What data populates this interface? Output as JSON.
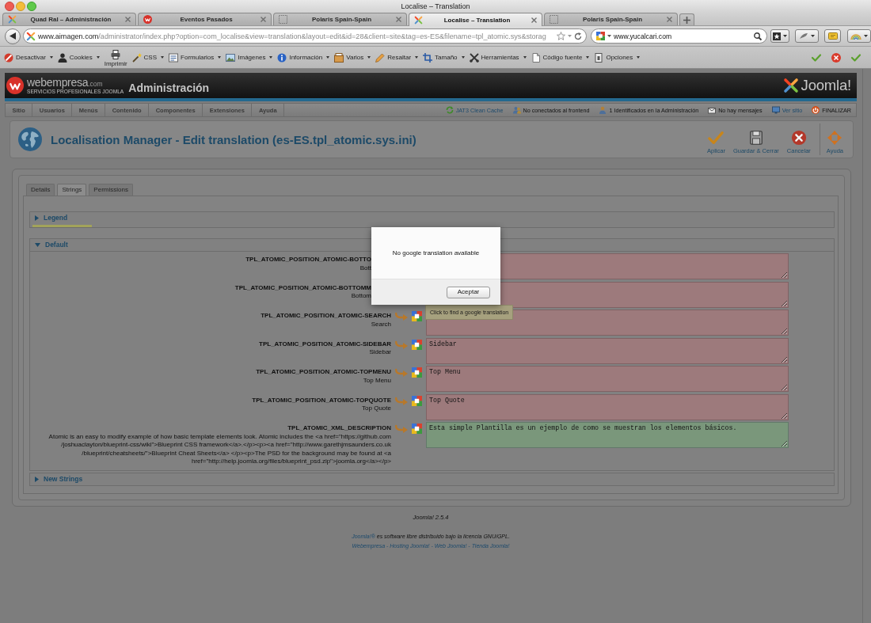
{
  "window": {
    "title": "Localise – Translation"
  },
  "tabs": [
    {
      "title": "Quad Ral – Administración",
      "kind": "joomla",
      "selected": false
    },
    {
      "title": "Eventos Pasados",
      "kind": "webempresa",
      "selected": false
    },
    {
      "title": "Polaris Spain-Spain",
      "kind": "blank",
      "selected": false
    },
    {
      "title": "Localise – Translation",
      "kind": "joomla",
      "selected": true
    },
    {
      "title": "Polaris Spain-Spain",
      "kind": "blank",
      "selected": false
    }
  ],
  "address_bar": {
    "host": "www.aimagen.com",
    "path": "/administrator/index.php?option=com_localise&view=translation&layout=edit&id=28&client=site&tag=es-ES&filename=tpl_atomic.sys&storag"
  },
  "search_field": {
    "value": "www.yucalcari.com"
  },
  "developer_toolbar": {
    "items": [
      {
        "label": "Desactivar",
        "kind": "menu"
      },
      {
        "label": "Cookies",
        "kind": "menu"
      },
      {
        "label": "Imprimir",
        "kind": "stacked"
      },
      {
        "label": "CSS",
        "kind": "menu"
      },
      {
        "label": "Formularios",
        "kind": "menu"
      },
      {
        "label": "Imágenes",
        "kind": "menu"
      },
      {
        "label": "Información",
        "kind": "menu"
      },
      {
        "label": "Varios",
        "kind": "menu"
      },
      {
        "label": "Resaltar",
        "kind": "menu"
      },
      {
        "label": "Tamaño",
        "kind": "menu"
      },
      {
        "label": "Herramientas",
        "kind": "menu"
      },
      {
        "label": "Código fuente",
        "kind": "menu"
      },
      {
        "label": "Opciones",
        "kind": "menu"
      }
    ]
  },
  "admin_header": {
    "brand": "webempresa",
    "brand_domain": ".com",
    "brand_tagline": "SERVICIOS PROFESIONALES JOOMLA",
    "title": "Administración",
    "cms_name": "Joomla!"
  },
  "admin_menu": {
    "items": [
      "Sitio",
      "Usuarios",
      "Menús",
      "Contenido",
      "Componentes",
      "Extensiones",
      "Ayuda"
    ],
    "status": [
      {
        "label": "JAT3 Clean Cache",
        "kind": "link"
      },
      {
        "label": "No conectados al frontend",
        "kind": "text"
      },
      {
        "label": "1 Identificados en la Administración",
        "kind": "text"
      },
      {
        "label": "No hay mensajes",
        "kind": "text"
      },
      {
        "label": "Ver sitio",
        "kind": "link"
      },
      {
        "label": "FINALIZAR",
        "kind": "text"
      }
    ]
  },
  "toolbar": {
    "title": "Localisation Manager - Edit translation (es-ES.tpl_atomic.sys.ini)",
    "buttons": [
      {
        "label": "Aplicar"
      },
      {
        "label": "Guardar & Cerrar"
      },
      {
        "label": "Cancelar"
      },
      {
        "label": "Ayuda"
      }
    ]
  },
  "edit_tabs": [
    {
      "label": "Details",
      "selected": false
    },
    {
      "label": "Strings",
      "selected": true
    },
    {
      "label": "Permissions",
      "selected": false
    }
  ],
  "sections": [
    {
      "title": "Legend",
      "kind": "legend",
      "expanded": false
    },
    {
      "title": "Default",
      "kind": "strings",
      "expanded": true,
      "rows": [
        {
          "kind": "covered",
          "key": "TPL_ATOMIC_POSITION_ATOMIC-BOTTO",
          "source": "Bott",
          "translated": false
        },
        {
          "kind": "covered",
          "key": "TPL_ATOMIC_POSITION_ATOMIC-BOTTOMM",
          "source": "Bottom",
          "translated": false
        },
        {
          "kind": "full",
          "key": "TPL_ATOMIC_POSITION_ATOMIC-SEARCH",
          "source": "Search",
          "translated": false,
          "tooltip": "Click to find a google translation"
        },
        {
          "kind": "full",
          "key": "TPL_ATOMIC_POSITION_ATOMIC-SIDEBAR",
          "source": "Sidebar",
          "translation": "Sidebar",
          "translated": false
        },
        {
          "kind": "full",
          "key": "TPL_ATOMIC_POSITION_ATOMIC-TOPMENU",
          "source": "Top Menu",
          "translation": "Top Menu",
          "translated": false
        },
        {
          "kind": "full",
          "key": "TPL_ATOMIC_POSITION_ATOMIC-TOPQUOTE",
          "source": "Top Quote",
          "translation": "Top Quote",
          "translated": false
        },
        {
          "kind": "full",
          "key": "TPL_ATOMIC_XML_DESCRIPTION",
          "source": "Atomic is an easy to modify example of how basic template elements look. Atomic includes the <a href=\"https://github.com\n/joshuaclayton/blueprint-css/wiki\">Blueprint CSS framework</a>.</p><p><a href=\"http://www.garethjmsaunders.co.uk\n/blueprint/cheatsheets/\">Blueprint Cheat Sheets</a> </p><p>The PSD for the background may be found at <a\nhref=\"http://help.joomla.org/files/blueprint_psd.zip\">joomla.org</a></p>",
          "translation": "Esta simple Plantilla es un ejemplo de como se muestran los elementos básicos.",
          "translated": true
        }
      ]
    },
    {
      "title": "New Strings",
      "kind": "new",
      "expanded": false
    }
  ],
  "dialog": {
    "message": "No google translation available",
    "button": "Aceptar"
  },
  "footer": {
    "version": "Joomla! 2.5.4",
    "license_link": "Joomla!®",
    "license_text": "es software libre distribuido bajo la licencia GNU/GPL.",
    "links": "Webempresa - Hosting Joomla! - Web Joomla! - Tienda Joomla!"
  }
}
